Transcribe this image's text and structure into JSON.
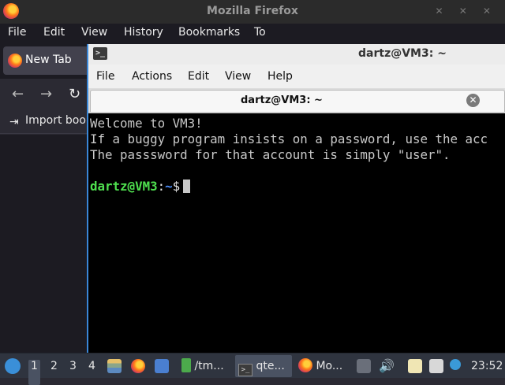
{
  "firefox": {
    "title": "Mozilla Firefox",
    "menu": [
      "File",
      "Edit",
      "View",
      "History",
      "Bookmarks",
      "To"
    ],
    "tab_label": "New Tab",
    "bookmark_label": "Import book"
  },
  "terminal": {
    "title": "dartz@VM3: ~",
    "menu": [
      "File",
      "Actions",
      "Edit",
      "View",
      "Help"
    ],
    "tab_label": "dartz@VM3: ~",
    "lines": [
      "Welcome to VM3!",
      "If a buggy program insists on a password, use the acc",
      "The passsword for that account is simply \"user\"."
    ],
    "prompt_user": "dartz@VM3",
    "prompt_sep": ":",
    "prompt_path": "~",
    "prompt_symbol": "$"
  },
  "taskbar": {
    "workspaces": [
      "1",
      "2",
      "3",
      "4"
    ],
    "active_workspace": "1",
    "tasks": [
      {
        "label": "/tm..."
      },
      {
        "label": "qte..."
      },
      {
        "label": "Mo..."
      }
    ],
    "clock": "23:52"
  },
  "colors": {
    "terminal_prompt_user": "#4fe04f",
    "terminal_prompt_path": "#4d8fff",
    "focus_border": "#3a87d8"
  }
}
